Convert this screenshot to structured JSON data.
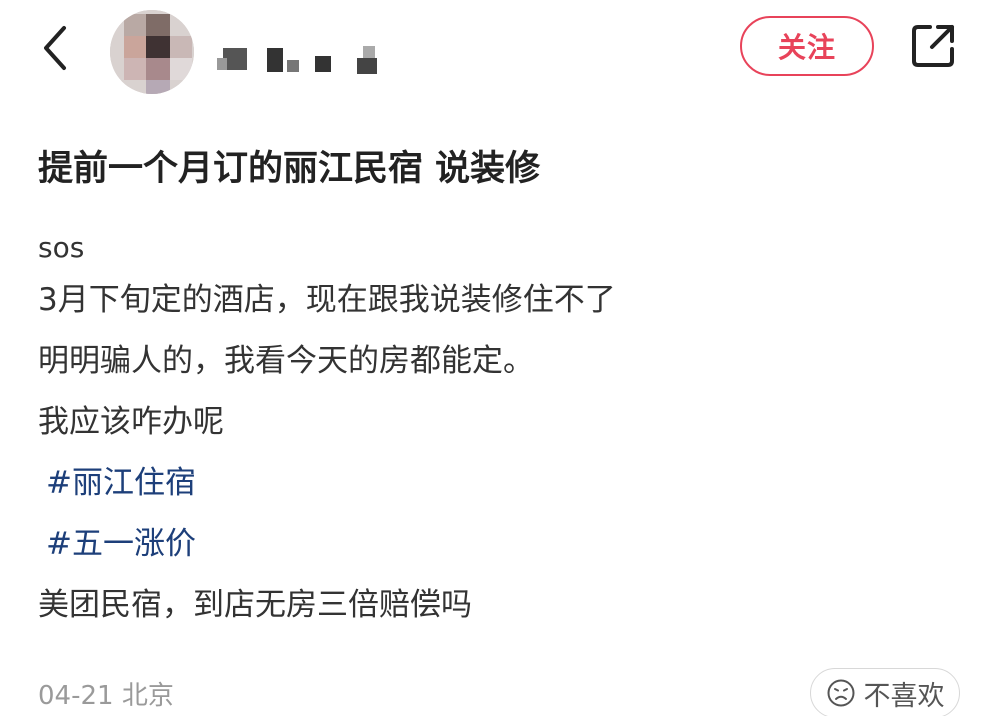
{
  "header": {
    "back_icon": "chevron-left-icon",
    "follow_label": "关注",
    "share_icon": "share-external-icon",
    "accent_color": "#e8435a"
  },
  "post": {
    "title": "提前一个月订的丽江民宿 说装修",
    "lines": [
      "sos",
      "3月下旬定的酒店，现在跟我说装修住不了",
      "明明骗人的，我看今天的房都能定。",
      "我应该咋办呢"
    ],
    "tags": [
      "#丽江住宿",
      "#五一涨价"
    ],
    "last_line": "美团民宿，到店无房三倍赔偿吗",
    "tag_color": "#1d3f7a"
  },
  "footer": {
    "date_location": "04-21 北京",
    "dislike_label": "不喜欢",
    "dislike_icon": "frown-face-icon"
  }
}
